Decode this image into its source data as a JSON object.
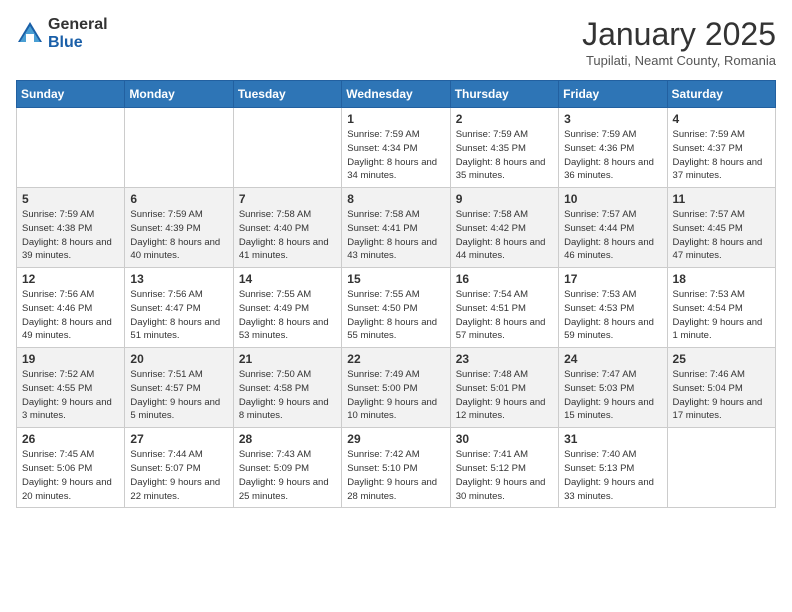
{
  "logo": {
    "general": "General",
    "blue": "Blue"
  },
  "title": "January 2025",
  "subtitle": "Tupilati, Neamt County, Romania",
  "days_header": [
    "Sunday",
    "Monday",
    "Tuesday",
    "Wednesday",
    "Thursday",
    "Friday",
    "Saturday"
  ],
  "weeks": [
    [
      {
        "day": "",
        "info": ""
      },
      {
        "day": "",
        "info": ""
      },
      {
        "day": "",
        "info": ""
      },
      {
        "day": "1",
        "info": "Sunrise: 7:59 AM\nSunset: 4:34 PM\nDaylight: 8 hours\nand 34 minutes."
      },
      {
        "day": "2",
        "info": "Sunrise: 7:59 AM\nSunset: 4:35 PM\nDaylight: 8 hours\nand 35 minutes."
      },
      {
        "day": "3",
        "info": "Sunrise: 7:59 AM\nSunset: 4:36 PM\nDaylight: 8 hours\nand 36 minutes."
      },
      {
        "day": "4",
        "info": "Sunrise: 7:59 AM\nSunset: 4:37 PM\nDaylight: 8 hours\nand 37 minutes."
      }
    ],
    [
      {
        "day": "5",
        "info": "Sunrise: 7:59 AM\nSunset: 4:38 PM\nDaylight: 8 hours\nand 39 minutes."
      },
      {
        "day": "6",
        "info": "Sunrise: 7:59 AM\nSunset: 4:39 PM\nDaylight: 8 hours\nand 40 minutes."
      },
      {
        "day": "7",
        "info": "Sunrise: 7:58 AM\nSunset: 4:40 PM\nDaylight: 8 hours\nand 41 minutes."
      },
      {
        "day": "8",
        "info": "Sunrise: 7:58 AM\nSunset: 4:41 PM\nDaylight: 8 hours\nand 43 minutes."
      },
      {
        "day": "9",
        "info": "Sunrise: 7:58 AM\nSunset: 4:42 PM\nDaylight: 8 hours\nand 44 minutes."
      },
      {
        "day": "10",
        "info": "Sunrise: 7:57 AM\nSunset: 4:44 PM\nDaylight: 8 hours\nand 46 minutes."
      },
      {
        "day": "11",
        "info": "Sunrise: 7:57 AM\nSunset: 4:45 PM\nDaylight: 8 hours\nand 47 minutes."
      }
    ],
    [
      {
        "day": "12",
        "info": "Sunrise: 7:56 AM\nSunset: 4:46 PM\nDaylight: 8 hours\nand 49 minutes."
      },
      {
        "day": "13",
        "info": "Sunrise: 7:56 AM\nSunset: 4:47 PM\nDaylight: 8 hours\nand 51 minutes."
      },
      {
        "day": "14",
        "info": "Sunrise: 7:55 AM\nSunset: 4:49 PM\nDaylight: 8 hours\nand 53 minutes."
      },
      {
        "day": "15",
        "info": "Sunrise: 7:55 AM\nSunset: 4:50 PM\nDaylight: 8 hours\nand 55 minutes."
      },
      {
        "day": "16",
        "info": "Sunrise: 7:54 AM\nSunset: 4:51 PM\nDaylight: 8 hours\nand 57 minutes."
      },
      {
        "day": "17",
        "info": "Sunrise: 7:53 AM\nSunset: 4:53 PM\nDaylight: 8 hours\nand 59 minutes."
      },
      {
        "day": "18",
        "info": "Sunrise: 7:53 AM\nSunset: 4:54 PM\nDaylight: 9 hours\nand 1 minute."
      }
    ],
    [
      {
        "day": "19",
        "info": "Sunrise: 7:52 AM\nSunset: 4:55 PM\nDaylight: 9 hours\nand 3 minutes."
      },
      {
        "day": "20",
        "info": "Sunrise: 7:51 AM\nSunset: 4:57 PM\nDaylight: 9 hours\nand 5 minutes."
      },
      {
        "day": "21",
        "info": "Sunrise: 7:50 AM\nSunset: 4:58 PM\nDaylight: 9 hours\nand 8 minutes."
      },
      {
        "day": "22",
        "info": "Sunrise: 7:49 AM\nSunset: 5:00 PM\nDaylight: 9 hours\nand 10 minutes."
      },
      {
        "day": "23",
        "info": "Sunrise: 7:48 AM\nSunset: 5:01 PM\nDaylight: 9 hours\nand 12 minutes."
      },
      {
        "day": "24",
        "info": "Sunrise: 7:47 AM\nSunset: 5:03 PM\nDaylight: 9 hours\nand 15 minutes."
      },
      {
        "day": "25",
        "info": "Sunrise: 7:46 AM\nSunset: 5:04 PM\nDaylight: 9 hours\nand 17 minutes."
      }
    ],
    [
      {
        "day": "26",
        "info": "Sunrise: 7:45 AM\nSunset: 5:06 PM\nDaylight: 9 hours\nand 20 minutes."
      },
      {
        "day": "27",
        "info": "Sunrise: 7:44 AM\nSunset: 5:07 PM\nDaylight: 9 hours\nand 22 minutes."
      },
      {
        "day": "28",
        "info": "Sunrise: 7:43 AM\nSunset: 5:09 PM\nDaylight: 9 hours\nand 25 minutes."
      },
      {
        "day": "29",
        "info": "Sunrise: 7:42 AM\nSunset: 5:10 PM\nDaylight: 9 hours\nand 28 minutes."
      },
      {
        "day": "30",
        "info": "Sunrise: 7:41 AM\nSunset: 5:12 PM\nDaylight: 9 hours\nand 30 minutes."
      },
      {
        "day": "31",
        "info": "Sunrise: 7:40 AM\nSunset: 5:13 PM\nDaylight: 9 hours\nand 33 minutes."
      },
      {
        "day": "",
        "info": ""
      }
    ]
  ]
}
